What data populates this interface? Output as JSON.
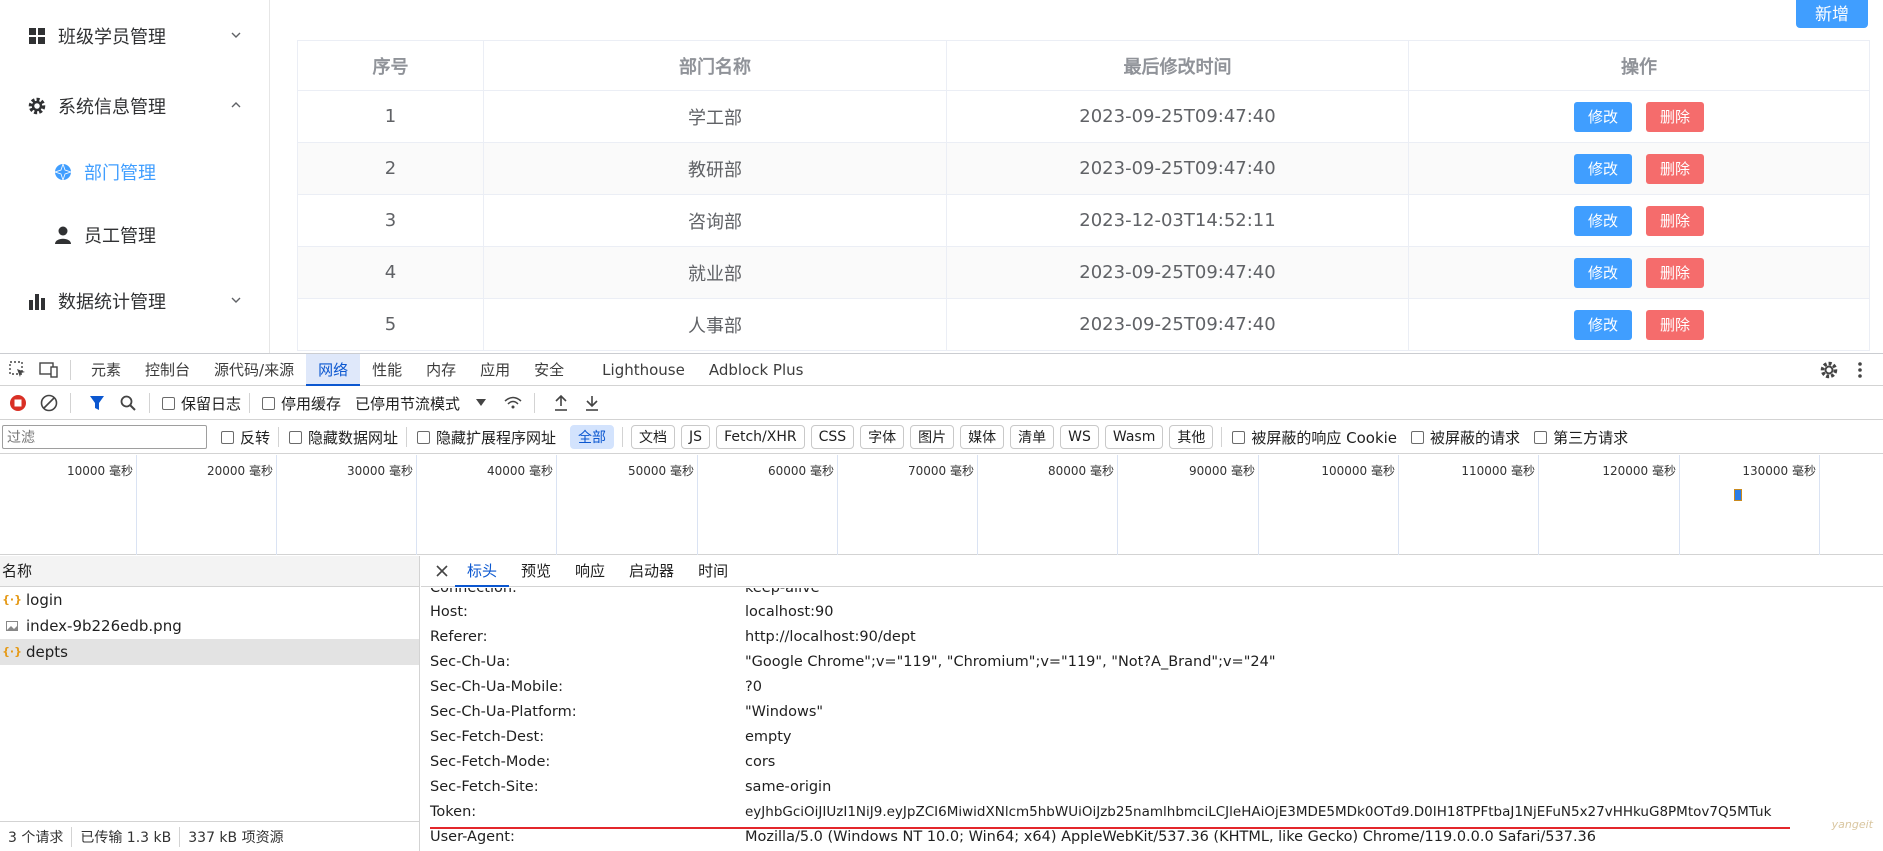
{
  "sidebar": {
    "items": [
      {
        "label": "班级学员管理",
        "icon": "grid-icon",
        "expanded": false
      },
      {
        "label": "系统信息管理",
        "icon": "gear-icon",
        "expanded": true
      },
      {
        "label": "部门管理",
        "icon": "dept-icon",
        "active": true
      },
      {
        "label": "员工管理",
        "icon": "user-icon"
      },
      {
        "label": "数据统计管理",
        "icon": "bar-chart-icon",
        "expanded": false
      }
    ]
  },
  "main": {
    "add_label": "新增",
    "columns": [
      "序号",
      "部门名称",
      "最后修改时间",
      "操作"
    ],
    "rows": [
      {
        "no": "1",
        "name": "学工部",
        "time": "2023-09-25T09:47:40"
      },
      {
        "no": "2",
        "name": "教研部",
        "time": "2023-09-25T09:47:40"
      },
      {
        "no": "3",
        "name": "咨询部",
        "time": "2023-12-03T14:52:11"
      },
      {
        "no": "4",
        "name": "就业部",
        "time": "2023-09-25T09:47:40"
      },
      {
        "no": "5",
        "name": "人事部",
        "time": "2023-09-25T09:47:40"
      }
    ],
    "edit_label": "修改",
    "delete_label": "删除"
  },
  "devtools": {
    "tabs": [
      "元素",
      "控制台",
      "源代码/来源",
      "网络",
      "性能",
      "内存",
      "应用",
      "安全",
      "Lighthouse",
      "Adblock Plus"
    ],
    "active_tab": "网络",
    "toolbar": {
      "preserve_log": "保留日志",
      "disable_cache": "停用缓存",
      "throttle": "已停用节流模式"
    },
    "filter": {
      "placeholder": "过滤",
      "invert": "反转",
      "hide_data_urls": "隐藏数据网址",
      "hide_ext_urls": "隐藏扩展程序网址",
      "chips": [
        "全部",
        "文档",
        "JS",
        "Fetch/XHR",
        "CSS",
        "字体",
        "图片",
        "媒体",
        "清单",
        "WS",
        "Wasm",
        "其他"
      ],
      "blocked_cookies": "被屏蔽的响应 Cookie",
      "blocked_requests": "被屏蔽的请求",
      "third_party": "第三方请求"
    },
    "timeline_labels": [
      "10000 毫秒",
      "20000 毫秒",
      "30000 毫秒",
      "40000 毫秒",
      "50000 毫秒",
      "60000 毫秒",
      "70000 毫秒",
      "80000 毫秒",
      "90000 毫秒",
      "100000 毫秒",
      "110000 毫秒",
      "120000 毫秒",
      "130000 毫秒"
    ],
    "requests": {
      "header": "名称",
      "items": [
        {
          "name": "login",
          "type": "fetch"
        },
        {
          "name": "index-9b226edb.png",
          "type": "image"
        },
        {
          "name": "depts",
          "type": "fetch",
          "selected": true
        }
      ]
    },
    "status": {
      "requests": "3 个请求",
      "transferred": "已传输 1.3 kB",
      "resources": "337 kB 项资源"
    },
    "detail_tabs": [
      "标头",
      "预览",
      "响应",
      "启动器",
      "时间"
    ],
    "headers": [
      {
        "k": "Connection:",
        "v": "keep-alive"
      },
      {
        "k": "Host:",
        "v": "localhost:90"
      },
      {
        "k": "Referer:",
        "v": "http://localhost:90/dept"
      },
      {
        "k": "Sec-Ch-Ua:",
        "v": "\"Google Chrome\";v=\"119\", \"Chromium\";v=\"119\", \"Not?A_Brand\";v=\"24\""
      },
      {
        "k": "Sec-Ch-Ua-Mobile:",
        "v": "?0"
      },
      {
        "k": "Sec-Ch-Ua-Platform:",
        "v": "\"Windows\""
      },
      {
        "k": "Sec-Fetch-Dest:",
        "v": "empty"
      },
      {
        "k": "Sec-Fetch-Mode:",
        "v": "cors"
      },
      {
        "k": "Sec-Fetch-Site:",
        "v": "same-origin"
      },
      {
        "k": "Token:",
        "v": "eyJhbGciOiJIUzI1NiJ9.eyJpZCI6MiwidXNlcm5hbWUiOiJzb25namlhbmciLCJleHAiOjE3MDE5MDk0OTd9.D0IH18TPFtbaJ1NjEFuN5x27vHHkuG8PMtov7Q5MTuk"
      },
      {
        "k": "User-Agent:",
        "v": "Mozilla/5.0 (Windows NT 10.0; Win64; x64) AppleWebKit/537.36 (KHTML, like Gecko) Chrome/119.0.0.0 Safari/537.36"
      }
    ],
    "watermark": "yangeit"
  },
  "colors": {
    "primary": "#409eff",
    "danger": "#f56c6c",
    "devtools_accent": "#0b57d0",
    "highlight": "#e3262b"
  }
}
